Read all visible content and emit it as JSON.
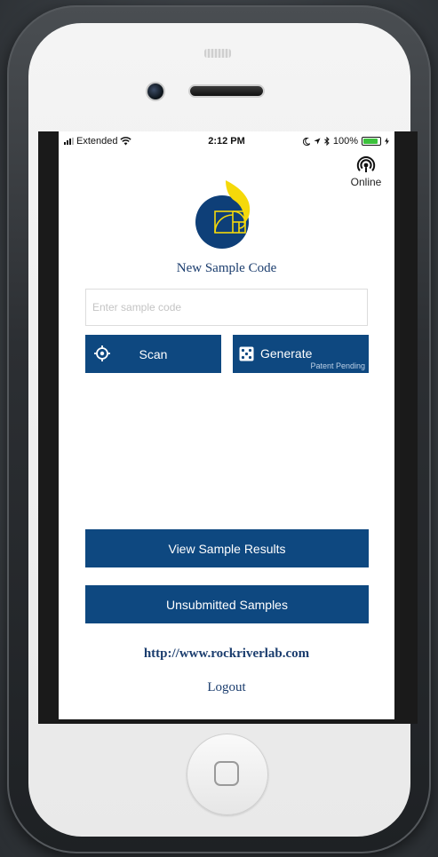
{
  "status_bar": {
    "carrier": "Extended",
    "time": "2:12 PM",
    "battery": "100%"
  },
  "connection": {
    "label": "Online"
  },
  "app": {
    "title": "New Sample Code"
  },
  "sample_input": {
    "placeholder": "Enter sample code",
    "value": ""
  },
  "actions": {
    "scan_label": "Scan",
    "generate_label": "Generate",
    "generate_sub": "Patent Pending",
    "view_results_label": "View Sample Results",
    "unsubmitted_label": "Unsubmitted Samples"
  },
  "links": {
    "website": "http://www.rockriverlab.com",
    "logout": "Logout"
  },
  "icons": {
    "wifi": "wifi-icon",
    "location": "location-arrow-icon",
    "bluetooth": "bluetooth-icon",
    "moon": "do-not-disturb-icon",
    "online": "broadcast-icon",
    "scan": "crosshair-icon",
    "generate": "dice-icon"
  },
  "colors": {
    "brand_blue": "#0e4880",
    "title_blue": "#1b3d6e",
    "logo_yellow": "#f5d90a",
    "battery_green": "#3cc23c"
  }
}
